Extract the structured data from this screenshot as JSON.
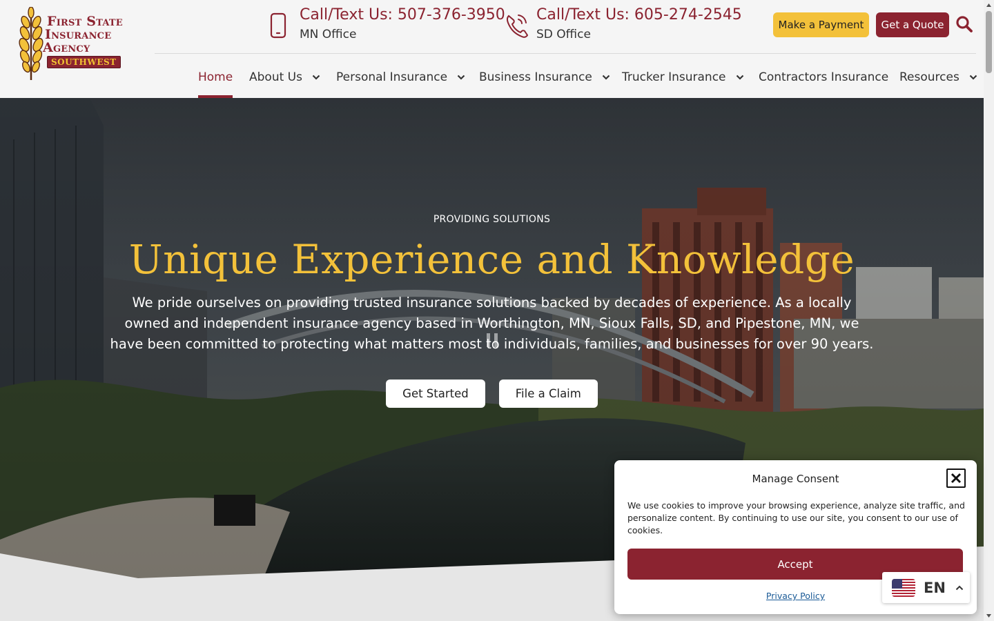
{
  "logo": {
    "line1": "First State",
    "line2": "Insurance",
    "line3": "Agency",
    "badge": "SOUTHWEST"
  },
  "contacts": [
    {
      "title": "Call/Text Us: 507-376-3950",
      "subtitle": "MN Office",
      "icon": "mobile-phone-icon"
    },
    {
      "title": "Call/Text Us: 605-274-2545",
      "subtitle": "SD Office",
      "icon": "phone-icon"
    }
  ],
  "header_buttons": {
    "payment": "Make a Payment",
    "quote": "Get a Quote",
    "search_icon": "search-icon"
  },
  "nav": {
    "items": [
      {
        "label": "Home",
        "active": true,
        "dropdown": false
      },
      {
        "label": "About Us",
        "dropdown": true
      },
      {
        "label": "Personal Insurance",
        "dropdown": true
      },
      {
        "label": "Business Insurance",
        "dropdown": true
      },
      {
        "label": "Trucker Insurance",
        "dropdown": true
      },
      {
        "label": "Contractors Insurance",
        "dropdown": false
      },
      {
        "label": "Resources",
        "dropdown": true
      }
    ]
  },
  "hero": {
    "eyebrow": "PROVIDING SOLUTIONS",
    "headline": "Unique Experience and Knowledge",
    "body": "We pride ourselves on providing trusted insurance solutions backed by decades of experience. As a locally owned and independent insurance agency based in Worthington, MN, Sioux Falls, SD, and Pipestone, MN, we have been committed to protecting what matters most to individuals, families, and businesses for over 90 years.",
    "cta_primary": "Get Started",
    "cta_secondary": "File a Claim"
  },
  "consent": {
    "title": "Manage Consent",
    "text": "We use cookies to improve your browsing experience, analyze site traffic, and personalize content. By continuing to use our site, you consent to our use of cookies.",
    "accept": "Accept",
    "privacy": "Privacy Policy"
  },
  "language": {
    "code": "EN"
  },
  "colors": {
    "brand": "#8b2330",
    "accent": "#f3c13a",
    "header_bg": "#f5f5f5"
  }
}
